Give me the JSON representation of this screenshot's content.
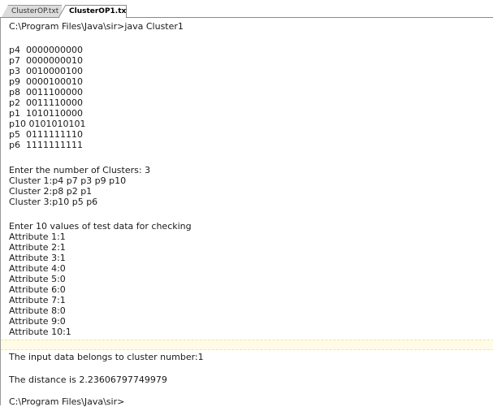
{
  "tabs": [
    {
      "label": "ClusterOP.txt",
      "active": false
    },
    {
      "label": "ClusterOP1.txt",
      "active": true
    }
  ],
  "console": {
    "lines": [
      "C:\\Program Files\\Java\\sir>java Cluster1",
      "",
      "p4  0000000000",
      "p7  0000000010",
      "p3  0010000100",
      "p9  0000100010",
      "p8  0011100000",
      "p2  0011110000",
      "p1  1010110000",
      "p10 0101010101",
      "p5  0111111110",
      "p6  1111111111",
      "",
      "Enter the number of Clusters: 3",
      "Cluster 1:p4 p7 p3 p9 p10",
      "Cluster 2:p8 p2 p1",
      "Cluster 3:p10 p5 p6",
      "",
      "Enter 10 values of test data for checking",
      "Attribute 1:1",
      "Attribute 2:1",
      "Attribute 3:1",
      "Attribute 4:0",
      "Attribute 5:0",
      "Attribute 6:0",
      "Attribute 7:1",
      "Attribute 8:0",
      "Attribute 9:0",
      "Attribute 10:1",
      "",
      "The input data belongs to cluster number:1",
      "",
      "The distance is 2.23606797749979",
      "",
      "C:\\Program Files\\Java\\sir>"
    ]
  },
  "colors": {
    "highlight_line": "#fffbe6",
    "text": "#1a1a1a"
  }
}
